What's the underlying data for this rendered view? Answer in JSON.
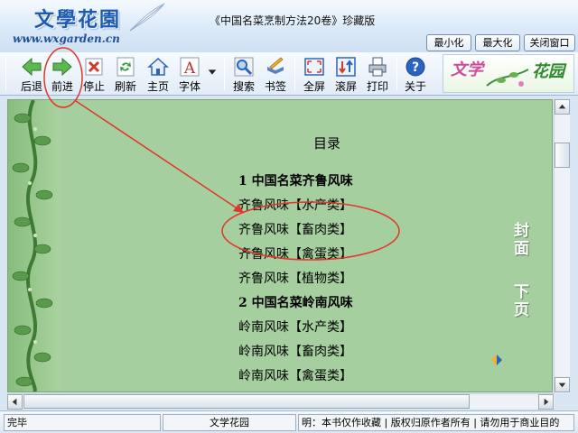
{
  "window": {
    "logo_title": "文學花園",
    "logo_url": "www.wxgarden.cn",
    "title": "《中国名菜烹制方法20卷》珍藏版",
    "buttons": {
      "minimize": "最小化",
      "maximize": "最大化",
      "close": "关闭窗口"
    }
  },
  "toolbar": {
    "items": [
      {
        "label": "后退",
        "icon": "back-arrow-icon",
        "color": "#3fa03a"
      },
      {
        "label": "前进",
        "icon": "forward-arrow-icon",
        "color": "#3fa03a"
      },
      {
        "label": "停止",
        "icon": "stop-icon",
        "color": "#d23a2a"
      },
      {
        "label": "刷新",
        "icon": "refresh-icon",
        "color": "#2f9a3b"
      },
      {
        "label": "主页",
        "icon": "home-icon",
        "color": "#2a64c0"
      },
      {
        "label": "字体",
        "icon": "font-icon",
        "color": "#c0302a"
      },
      {
        "label": "搜索",
        "icon": "search-icon",
        "color": "#2a64c0"
      },
      {
        "label": "书签",
        "icon": "bookmark-icon",
        "color": "#d0901a"
      },
      {
        "label": "全屏",
        "icon": "fullscreen-icon",
        "color": "#2a64c0"
      },
      {
        "label": "滚屏",
        "icon": "autoscroll-icon",
        "color": "#2a64c0"
      },
      {
        "label": "打印",
        "icon": "printer-icon",
        "color": "#4a5a70"
      },
      {
        "label": "关于",
        "icon": "help-icon",
        "color": "#2a64c0"
      }
    ],
    "banner": {
      "left": "文学",
      "right": "花园"
    }
  },
  "content": {
    "toc_title": "目录",
    "lines": [
      {
        "text": "1  中国名菜齐鲁风味",
        "heading": true
      },
      {
        "text": "齐鲁风味【水产类】",
        "heading": false
      },
      {
        "text": "齐鲁风味【畜肉类】",
        "heading": false
      },
      {
        "text": "齐鲁风味【禽蛋类】",
        "heading": false
      },
      {
        "text": "齐鲁风味【植物类】",
        "heading": false
      },
      {
        "text": "2  中国名菜岭南风味",
        "heading": true
      },
      {
        "text": "岭南风味【水产类】",
        "heading": false
      },
      {
        "text": "岭南风味【畜肉类】",
        "heading": false
      },
      {
        "text": "岭南风味【禽蛋类】",
        "heading": false
      }
    ],
    "side_nav": {
      "cover": "封面",
      "next": "下页"
    },
    "background": "#a6cf9f"
  },
  "statusbar": {
    "status": "完毕",
    "site": "文学花园",
    "notice": "明：本书仅作收藏 | 版权归原作者所有 | 请勿用于商业目的"
  },
  "annotation": {
    "color": "#e2342a"
  }
}
